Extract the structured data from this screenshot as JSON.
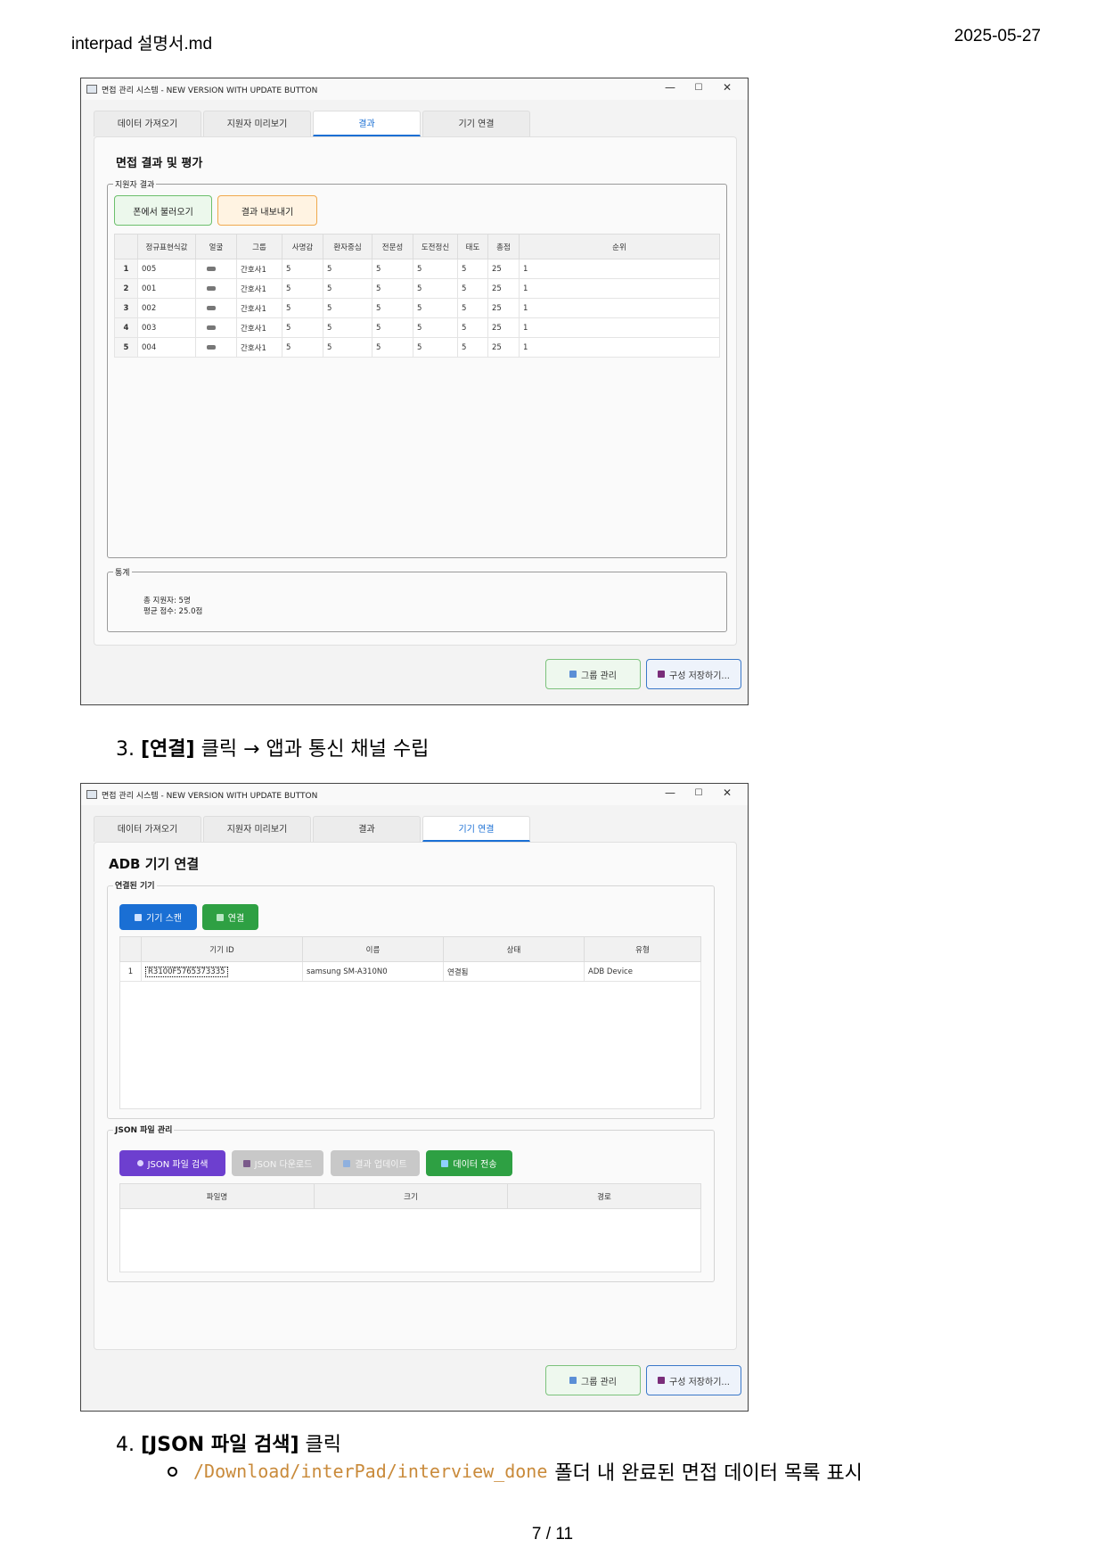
{
  "header": {
    "filename": "interpad 설명서.md",
    "date": "2025-05-27"
  },
  "footer": {
    "page": "7 / 11"
  },
  "window_title": "면접 관리 시스템 - NEW VERSION WITH UPDATE BUTTON",
  "window_controls": {
    "minimize": "—",
    "maximize": "☐",
    "close": "✕"
  },
  "tabs": [
    "데이터 가져오기",
    "지원자 미리보기",
    "결과",
    "기기 연결"
  ],
  "results_tab": {
    "title": "면접 결과 및 평가",
    "group_label": "지원자 결과",
    "load_button": "폰에서 불러오기",
    "export_button": "결과 내보내기",
    "columns": [
      "정규표현식값",
      "얼굴",
      "그룹",
      "사명감",
      "환자중심",
      "전문성",
      "도전정신",
      "태도",
      "총점",
      "순위"
    ],
    "rows": [
      {
        "n": "1",
        "id": "005",
        "group": "간호사1",
        "s1": "5",
        "s2": "5",
        "s3": "5",
        "s4": "5",
        "s5": "5",
        "total": "25",
        "rank": "1"
      },
      {
        "n": "2",
        "id": "001",
        "group": "간호사1",
        "s1": "5",
        "s2": "5",
        "s3": "5",
        "s4": "5",
        "s5": "5",
        "total": "25",
        "rank": "1"
      },
      {
        "n": "3",
        "id": "002",
        "group": "간호사1",
        "s1": "5",
        "s2": "5",
        "s3": "5",
        "s4": "5",
        "s5": "5",
        "total": "25",
        "rank": "1"
      },
      {
        "n": "4",
        "id": "003",
        "group": "간호사1",
        "s1": "5",
        "s2": "5",
        "s3": "5",
        "s4": "5",
        "s5": "5",
        "total": "25",
        "rank": "1"
      },
      {
        "n": "5",
        "id": "004",
        "group": "간호사1",
        "s1": "5",
        "s2": "5",
        "s3": "5",
        "s4": "5",
        "s5": "5",
        "total": "25",
        "rank": "1"
      }
    ],
    "stats_label": "통계",
    "stats_total": "총 지원자: 5명",
    "stats_avg": "평균 점수: 25.0점"
  },
  "bottom_buttons": {
    "group_manage": "그룹 관리",
    "save_config": "구성 저장하기..."
  },
  "step3": {
    "num": "3.",
    "bold": "[연결]",
    "rest": " 클릭 → 앱과 통신 채널 수립"
  },
  "device_tab": {
    "title": "ADB 기기 연결",
    "group_label": "연결된 기기",
    "scan_button": "기기 스캔",
    "connect_button": "연결",
    "columns": [
      "기기 ID",
      "이름",
      "상태",
      "유형"
    ],
    "rows": [
      {
        "n": "1",
        "device_id": "R3100F5765373335",
        "name": "samsung SM-A310N0",
        "status": "연결됨",
        "type": "ADB Device"
      }
    ],
    "json_group_label": "JSON 파일 관리",
    "json_search_button": "JSON 파일 검색",
    "json_download_button": "JSON 다운로드",
    "result_update_button": "결과 업데이트",
    "send_data_button": "데이터 전송",
    "file_columns": [
      "파일명",
      "크기",
      "경로"
    ]
  },
  "step4": {
    "num": "4.",
    "bold": "[JSON 파일 검색]",
    "rest": " 클릭"
  },
  "bullet": {
    "path": "/Download/interPad/interview_done",
    "text": "폴더 내 완료된 면접 데이터 목록 표시"
  }
}
